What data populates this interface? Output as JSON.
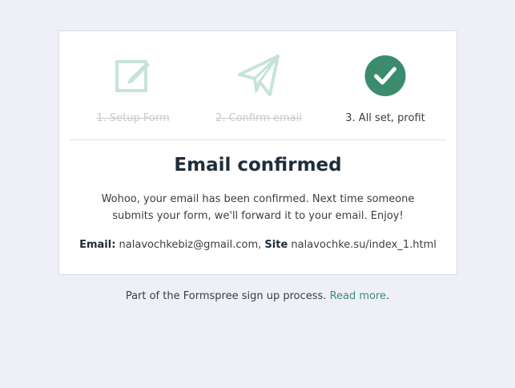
{
  "steps": [
    {
      "label": "1. Setup Form",
      "icon": "edit-icon",
      "state": "done"
    },
    {
      "label": "2. Confirm email",
      "icon": "paper-plane-icon",
      "state": "done"
    },
    {
      "label": "3. All set, profit",
      "icon": "checkmark-icon",
      "state": "current"
    }
  ],
  "title": "Email confirmed",
  "message": "Wohoo, your email has been confirmed. Next time someone submits your form, we'll forward it to your email. Enjoy!",
  "details": {
    "email_label": "Email:",
    "email_value": "nalavochkebiz@gmail.com",
    "separator": ",",
    "site_label": "Site",
    "site_value": "nalavochke.su/index_1.html"
  },
  "footer": {
    "text": "Part of the Formspree sign up process.",
    "link_label": "Read more",
    "trailing": "."
  },
  "colors": {
    "accent": "#3b8c6e",
    "done_icon": "#c7e3d8",
    "background": "#eff0f7"
  }
}
